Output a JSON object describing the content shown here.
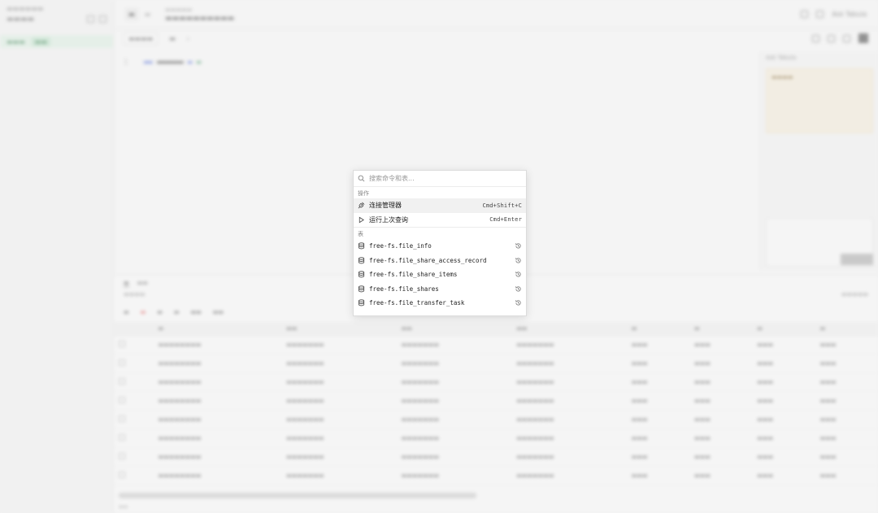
{
  "palette": {
    "search_placeholder": "搜索命令和表...",
    "section_actions": "操作",
    "actions": [
      {
        "label": "连接管理器",
        "shortcut": "Cmd+Shift+C",
        "icon": "plug-icon"
      },
      {
        "label": "运行上次查询",
        "shortcut": "Cmd+Enter",
        "icon": "play-icon"
      }
    ],
    "section_tables": "表",
    "tables": [
      {
        "label": "free-fs.file_info",
        "icon": "database-icon"
      },
      {
        "label": "free-fs.file_share_access_record",
        "icon": "database-icon"
      },
      {
        "label": "free-fs.file_share_items",
        "icon": "database-icon"
      },
      {
        "label": "free-fs.file_shares",
        "icon": "database-icon"
      },
      {
        "label": "free-fs.file_transfer_task",
        "icon": "database-icon"
      }
    ]
  },
  "ai_panel": {
    "header": "Ask Tabula"
  },
  "editor": {
    "line": "1"
  }
}
